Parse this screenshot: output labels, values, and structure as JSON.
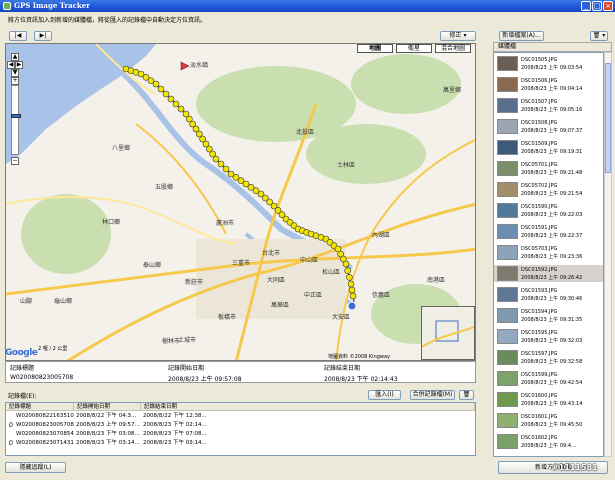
{
  "window": {
    "title": "GPS Image Tracker",
    "min": "_",
    "max": "□",
    "close": "×"
  },
  "instruction": "將方位資訊加入到新增的媒體檔，將從匯入的記錄檔中自動決定方位資訊。",
  "nav": {
    "prev": "|◀",
    "next": "▶|"
  },
  "map": {
    "edit_button": "修正 ▾",
    "types": [
      "地圖",
      "衛星",
      "混合地圖"
    ],
    "active_type": "地圖",
    "labels": [
      "淡水鎮",
      "八里鄉",
      "北投區",
      "士林區",
      "萬里鄉",
      "五股鄉",
      "蘆洲市",
      "三重市",
      "泰山鄉",
      "新莊市",
      "台北市",
      "中山區",
      "松山區",
      "內湖區",
      "大同區",
      "板橋市",
      "萬華區",
      "中正區",
      "大安區",
      "南港區",
      "樹林市",
      "林口鄉",
      "土城市",
      "信義區",
      "山腳",
      "龜山鄉"
    ],
    "google": "Google",
    "scale": "2 哩 / 2 公里",
    "copyright": "地圖資料 ©2008 Kingway"
  },
  "info": {
    "headers": [
      "記錄標題",
      "記錄開始日期",
      "記錄結束日期"
    ],
    "values": [
      "W020080823005708",
      "2008/8/23 上午 09:57:08",
      "2008/8/23 下午 02:14:43"
    ]
  },
  "tracks": {
    "label": "記錄檔(E):",
    "import": "匯入(I)",
    "merge": "合併記錄檔(M)",
    "delete_icon": "🗑",
    "columns": [
      "記錄標題",
      "記錄開始日期",
      "記錄結束日期"
    ],
    "rows": [
      [
        "W020080822163510",
        "2008/8/22 下午 04:3...",
        "2008/8/22 下午 12:38..."
      ],
      [
        "W020080823005708",
        "2008/8/23 上午 09:57...",
        "2008/8/23 下午 02:14..."
      ],
      [
        "W020080823070854",
        "2008/8/23 下午 03:08...",
        "2008/8/23 下午 07:08..."
      ],
      [
        "W020080823071431",
        "2008/8/23 下午 03:14...",
        "2008/8/23 下午 03:14..."
      ]
    ]
  },
  "photos": {
    "add_button": "新增檔案(A)...",
    "trash": "🗑 ▾",
    "header": "媒體檔",
    "items": [
      {
        "name": "DSC01505.JPG",
        "date": "2008/8/23 上午 09:03:54"
      },
      {
        "name": "DSC01506.JPG",
        "date": "2008/8/23 上午 09:04:14"
      },
      {
        "name": "DSC01507.JPG",
        "date": "2008/8/23 上午 09:05:16"
      },
      {
        "name": "DSC01508.JPG",
        "date": "2008/8/23 上午 09:07:37"
      },
      {
        "name": "DSC01509.JPG",
        "date": "2008/8/23 上午 09:19:31"
      },
      {
        "name": "DSC05701.JPG",
        "date": "2008/8/23 上午 09:21:48"
      },
      {
        "name": "DSC05702.JPG",
        "date": "2008/8/23 上午 09:21:54"
      },
      {
        "name": "DSC01590.JPG",
        "date": "2008/8/23 上午 09:22:03"
      },
      {
        "name": "DSC01591.JPG",
        "date": "2008/8/23 上午 09:22:37"
      },
      {
        "name": "DSC05703.JPG",
        "date": "2008/8/23 上午 09:23:36"
      },
      {
        "name": "DSC01592.JPG",
        "date": "2008/8/23 上午 09:26:42"
      },
      {
        "name": "DSC01593.JPG",
        "date": "2008/8/23 上午 09:30:46"
      },
      {
        "name": "DSC01594.JPG",
        "date": "2008/8/23 上午 09:31:35"
      },
      {
        "name": "DSC01595.JPG",
        "date": "2008/8/23 上午 09:32:03"
      },
      {
        "name": "DSC01597.JPG",
        "date": "2008/8/23 上午 09:32:58"
      },
      {
        "name": "DSC01599.JPG",
        "date": "2008/8/23 上午 09:42:54"
      },
      {
        "name": "DSC01600.JPG",
        "date": "2008/8/23 上午 09:43:14"
      },
      {
        "name": "DSC01601.JPG",
        "date": "2008/8/23 上午 09:45:50"
      },
      {
        "name": "DSC01602.JPG",
        "date": "2008/8/23 上午 09:4..."
      }
    ],
    "selected_index": 10,
    "thumb_colors": [
      "#6a5f52",
      "#8a6a4e",
      "#5b6e8c",
      "#9aa6b2",
      "#3e5a7a",
      "#7d8f6a",
      "#a38e6c",
      "#4f7a9a",
      "#6b8fb0",
      "#8fa3b8",
      "#7f7a6e",
      "#5c7894",
      "#829ab0",
      "#93a8bc",
      "#6a8c5c",
      "#7ea36a",
      "#6f9a4e",
      "#8fb06f",
      "#7a9f6a"
    ]
  },
  "bottom": {
    "hide_track": "隱藏追蹤(L)",
    "add_location": "新增方位資訊"
  },
  "watermark": "#1111581",
  "colors": {
    "marker": "#f2e500",
    "road": "#f6c94d",
    "water": "#a9c2e8",
    "green": "#c9dfb0"
  }
}
